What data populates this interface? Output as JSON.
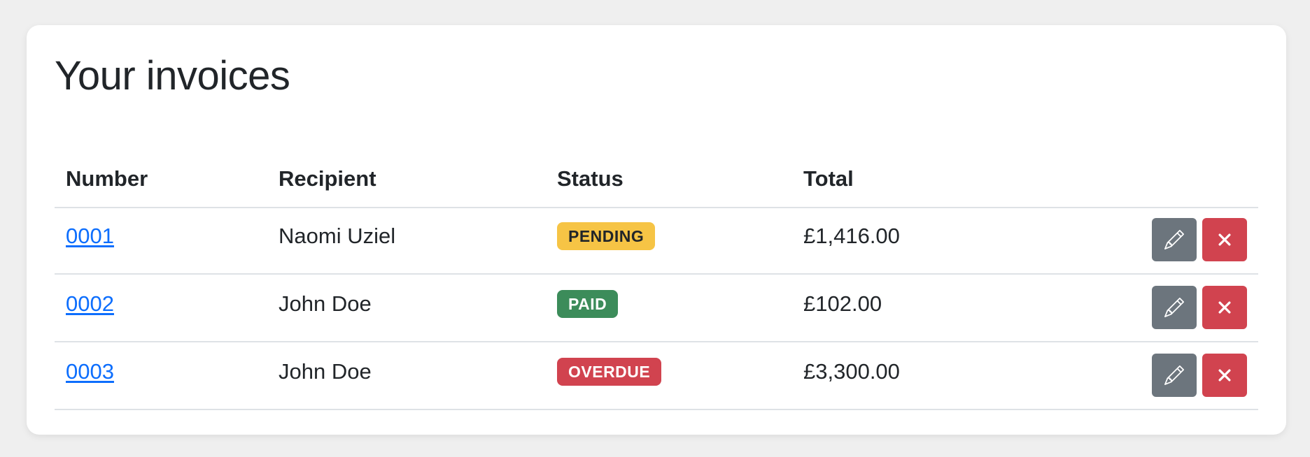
{
  "page": {
    "title": "Your invoices"
  },
  "table": {
    "headers": {
      "number": "Number",
      "recipient": "Recipient",
      "status": "Status",
      "total": "Total"
    },
    "rows": [
      {
        "number": "0001",
        "recipient": "Naomi Uziel",
        "status": "PENDING",
        "status_kind": "pending",
        "total": "£1,416.00"
      },
      {
        "number": "0002",
        "recipient": "John Doe",
        "status": "PAID",
        "status_kind": "paid",
        "total": "£102.00"
      },
      {
        "number": "0003",
        "recipient": "John Doe",
        "status": "OVERDUE",
        "status_kind": "overdue",
        "total": "£3,300.00"
      }
    ],
    "row_actions": {
      "edit_icon": "pencil-icon",
      "delete_icon": "close-icon"
    }
  },
  "colors": {
    "link": "#0d6efd",
    "pending": "#f6c445",
    "paid": "#3c8c5a",
    "overdue": "#d1434f",
    "edit_button": "#6c757d",
    "delete_button": "#d1434f"
  }
}
